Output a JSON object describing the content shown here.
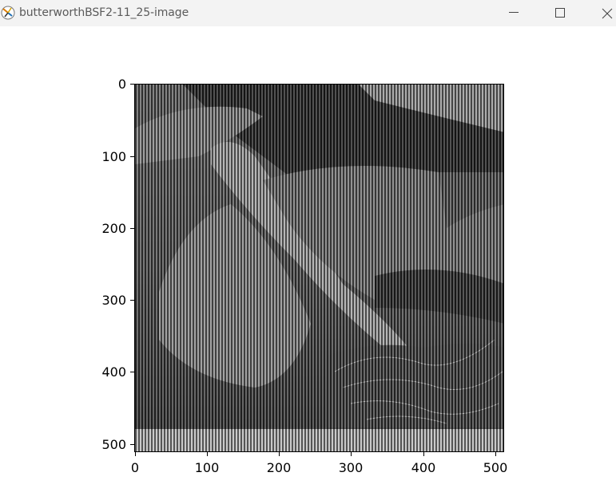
{
  "window": {
    "title": "butterworthBSF2-11_25-image",
    "app_icon": "matplotlib-figure-icon",
    "controls": [
      "minimize-icon",
      "maximize-icon",
      "close-icon"
    ]
  },
  "figure": {
    "image_description_colormap": "gray",
    "x_ticks": [
      "0",
      "100",
      "200",
      "300",
      "400",
      "500"
    ],
    "y_ticks": [
      "0",
      "100",
      "200",
      "300",
      "400",
      "500"
    ],
    "x_range": [
      0,
      512
    ],
    "y_range": [
      0,
      512
    ]
  },
  "colors": {
    "titlebar_bg": "#f3f3f3",
    "title_text": "#5a5a5a",
    "axis": "#000000"
  }
}
